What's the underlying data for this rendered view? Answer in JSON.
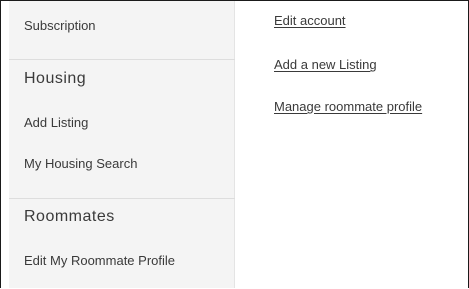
{
  "sidebar": {
    "subscription_label": "Subscription",
    "housing": {
      "heading": "Housing",
      "items": [
        {
          "label": "Add Listing"
        },
        {
          "label": "My Housing Search"
        }
      ]
    },
    "roommates": {
      "heading": "Roommates",
      "items": [
        {
          "label": "Edit My Roommate Profile"
        }
      ]
    }
  },
  "main": {
    "links": [
      {
        "label": "Edit account"
      },
      {
        "label": "Add a new Listing"
      },
      {
        "label": "Manage roommate profile"
      }
    ]
  },
  "colors": {
    "sidebar_background": "#f4f4f4",
    "text": "#3a3a3a",
    "frame_border": "#1a1a1a"
  }
}
